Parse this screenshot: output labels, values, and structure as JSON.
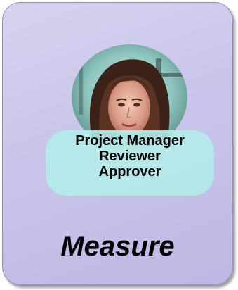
{
  "card": {
    "roles": [
      "Project Manager",
      "Reviewer",
      "Approver"
    ],
    "phase": "Measure"
  },
  "portrait": {
    "icon": "woman-portrait-photo"
  }
}
